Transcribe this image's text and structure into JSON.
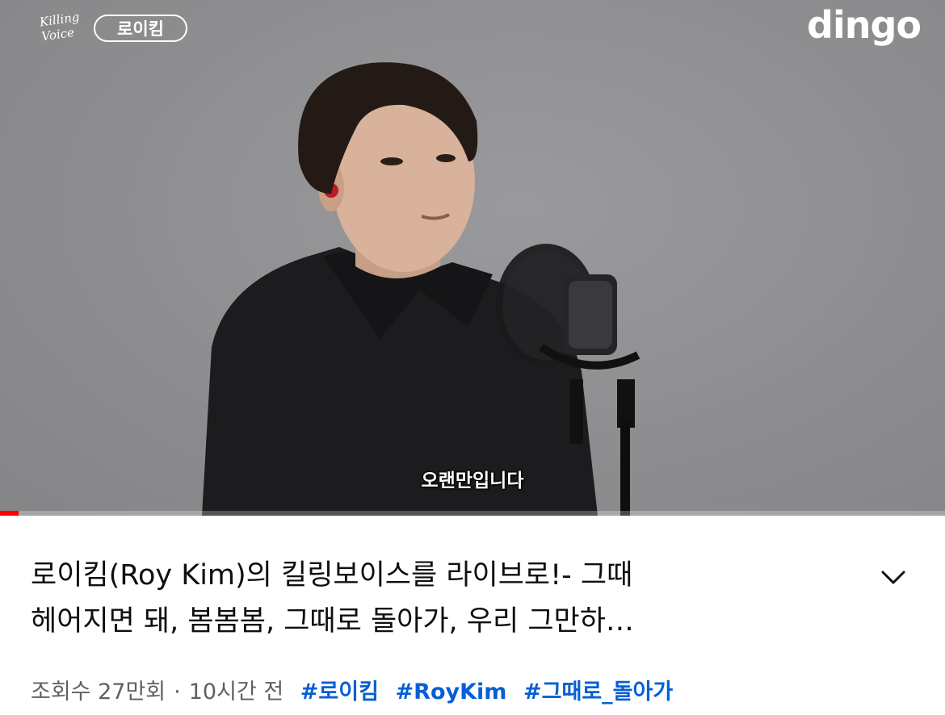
{
  "video": {
    "channel_logo": {
      "script": "Killing Voice",
      "pill": "로이킴"
    },
    "brand_logo": "dingo",
    "caption": "오랜만입니다",
    "progress": 0.02,
    "colors": {
      "progress": "#ff0000",
      "background": "#8e8e90"
    }
  },
  "title": {
    "line1": "로이킴(Roy Kim)의 킬링보이스를 라이브로!- 그때",
    "line2": "헤어지면 돼, 봄봄봄, 그때로 돌아가, 우리 그만하…"
  },
  "expand_icon": "chevron-down-icon",
  "meta": {
    "views": "조회수 27만회",
    "separator": "·",
    "time": "10시간 전",
    "hashtags": [
      "#로이킴",
      "#RoyKim",
      "#그때로_돌아가"
    ]
  },
  "colors": {
    "text": "#0f0f0f",
    "meta": "#606060",
    "hashtag": "#065fd4"
  }
}
